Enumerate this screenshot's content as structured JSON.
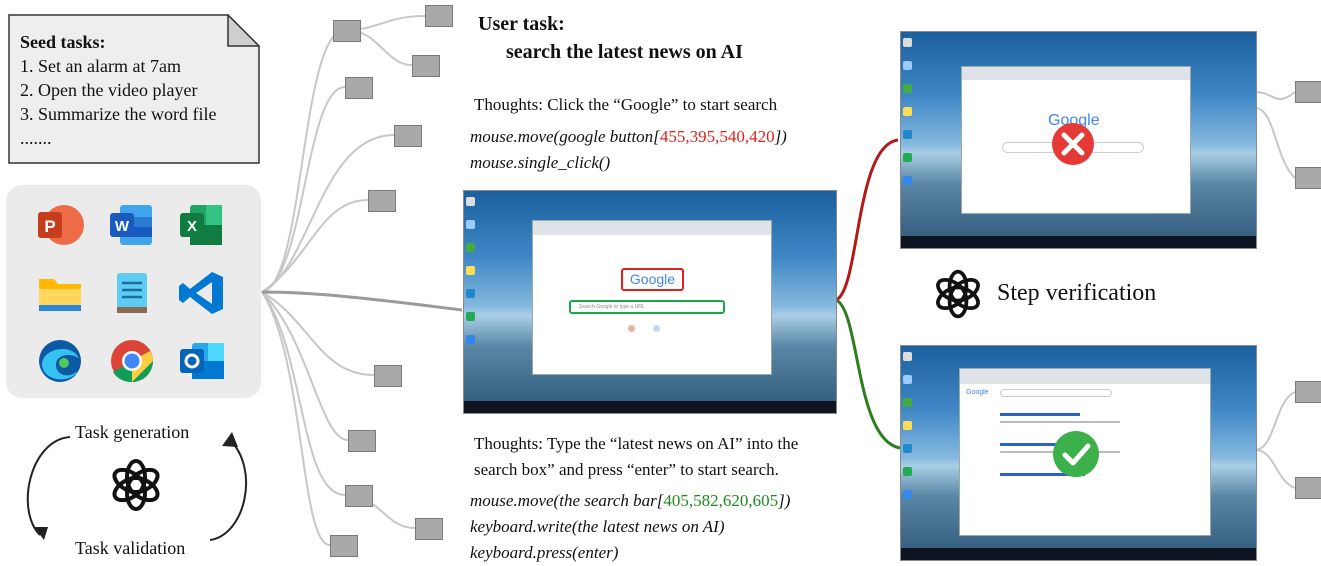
{
  "seed_tasks": {
    "title": "Seed tasks:",
    "items": [
      "1. Set an alarm at 7am",
      "2. Open the video player",
      "3. Summarize the word file",
      "......."
    ]
  },
  "apps": [
    "powerpoint-icon",
    "word-icon",
    "excel-icon",
    "file-explorer-icon",
    "notepad-icon",
    "vscode-icon",
    "edge-icon",
    "chrome-icon",
    "outlook-icon"
  ],
  "loop": {
    "top_label": "Task generation",
    "bottom_label": "Task validation"
  },
  "user_task": {
    "line1": "User task:",
    "line2": "search the latest news on AI"
  },
  "step1": {
    "thought": "Thoughts: Click the “Google” to start search",
    "code_prefix": "mouse.move(google button[",
    "coords": "455,395,540,420",
    "code_suffix": "])",
    "code_line2": "mouse.single_click()"
  },
  "step2": {
    "thought_line1": "Thoughts: Type the “latest news on AI” into the",
    "thought_line2": "search box” and press “enter” to start search.",
    "code_prefix": "mouse.move(the search bar[",
    "coords": "405,582,620,605",
    "code_suffix": "])",
    "code_line2": "keyboard.write(the latest news on AI)",
    "code_line3": "keyboard.press(enter)"
  },
  "verification": {
    "label": "Step verification"
  },
  "screenshot": {
    "logo": "Google",
    "placeholder": "Search Google or type a URL"
  },
  "colors": {
    "red": "#e0201a",
    "green": "#1f8a1f",
    "box_red": "#e0201a",
    "box_green": "#1aa64a"
  }
}
